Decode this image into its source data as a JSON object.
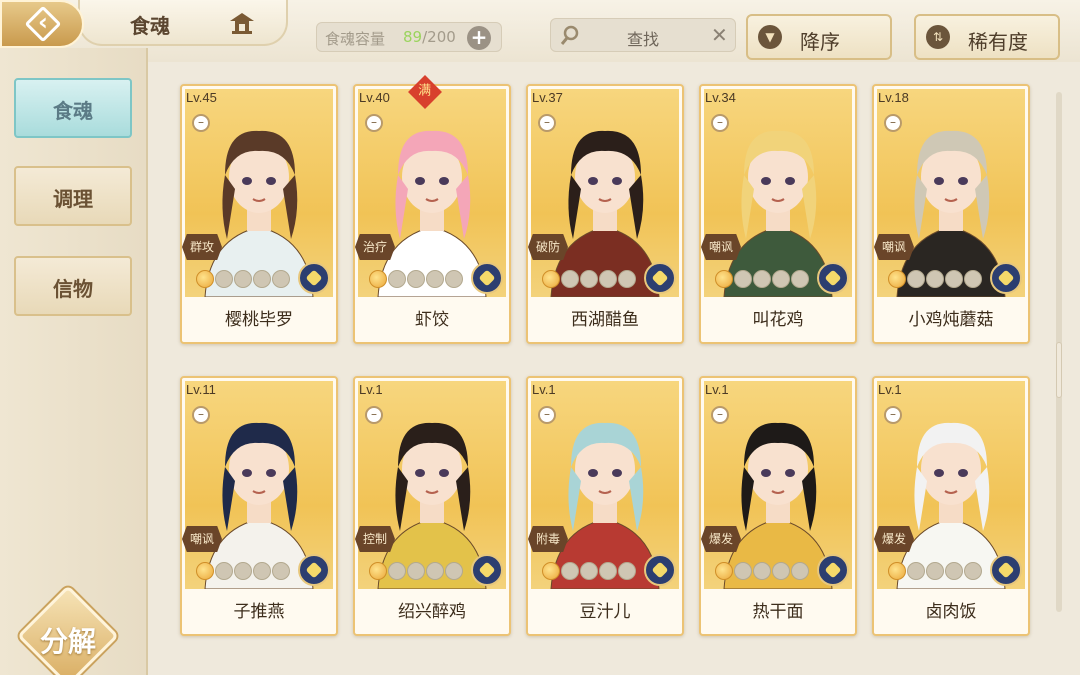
{
  "header": {
    "title": "食魂",
    "capacity_label": "食魂容量",
    "capacity_current": "89",
    "capacity_max": "/200",
    "search_placeholder": "查找",
    "sort_order_label": "降序",
    "sort_rarity_label": "稀有度"
  },
  "sidebar": {
    "tabs": [
      {
        "label": "食魂",
        "active": true
      },
      {
        "label": "调理",
        "active": false
      },
      {
        "label": "信物",
        "active": false
      }
    ],
    "decompose_label": "分解"
  },
  "cards": [
    {
      "level": "Lv.45",
      "role": "群攻",
      "name": "樱桃毕罗",
      "stars": 5,
      "full": false,
      "hair": "#5a3a28",
      "cloth": "#e8f0f0"
    },
    {
      "level": "Lv.40",
      "role": "治疗",
      "name": "虾饺",
      "stars": 5,
      "full": true,
      "full_label": "满",
      "hair": "#f4a6b8",
      "cloth": "#ffffff"
    },
    {
      "level": "Lv.37",
      "role": "破防",
      "name": "西湖醋鱼",
      "stars": 5,
      "full": false,
      "hair": "#2b1f1a",
      "cloth": "#7b2e22"
    },
    {
      "level": "Lv.34",
      "role": "嘲讽",
      "name": "叫花鸡",
      "stars": 5,
      "full": false,
      "hair": "#f1d37a",
      "cloth": "#3e5a3c"
    },
    {
      "level": "Lv.18",
      "role": "嘲讽",
      "name": "小鸡炖蘑菇",
      "stars": 5,
      "full": false,
      "hair": "#cfc8b5",
      "cloth": "#2a2622"
    },
    {
      "level": "Lv.11",
      "role": "嘲讽",
      "name": "子推燕",
      "stars": 5,
      "full": false,
      "hair": "#1f2a4a",
      "cloth": "#f4f2ec"
    },
    {
      "level": "Lv.1",
      "role": "控制",
      "name": "绍兴醉鸡",
      "stars": 5,
      "full": false,
      "hair": "#2a1f1a",
      "cloth": "#e3c24a"
    },
    {
      "level": "Lv.1",
      "role": "附毒",
      "name": "豆汁儿",
      "stars": 5,
      "full": false,
      "hair": "#a9d4d6",
      "cloth": "#b83a32"
    },
    {
      "level": "Lv.1",
      "role": "爆发",
      "name": "热干面",
      "stars": 5,
      "full": false,
      "hair": "#1e1a18",
      "cloth": "#e9b945"
    },
    {
      "level": "Lv.1",
      "role": "爆发",
      "name": "卤肉饭",
      "stars": 5,
      "full": false,
      "hair": "#f2f2f2",
      "cloth": "#f7f7f2"
    }
  ]
}
